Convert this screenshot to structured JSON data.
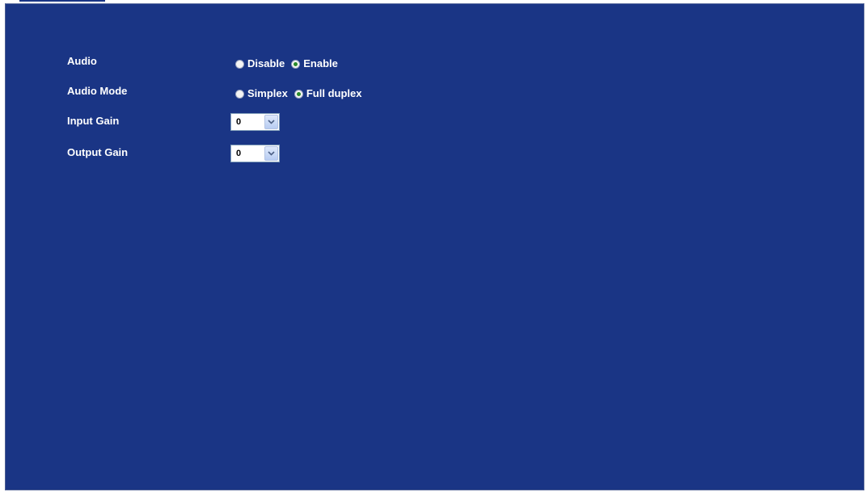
{
  "settings": {
    "audio": {
      "label": "Audio",
      "options": [
        "Disable",
        "Enable"
      ],
      "selected": "Enable"
    },
    "audio_mode": {
      "label": "Audio Mode",
      "options": [
        "Simplex",
        "Full duplex"
      ],
      "selected": "Full duplex"
    },
    "input_gain": {
      "label": "Input Gain",
      "value": "0"
    },
    "output_gain": {
      "label": "Output Gain",
      "value": "0"
    }
  },
  "colors": {
    "panel_background": "#1a3585",
    "text": "#ffffff",
    "radio_checked_dot": "#2a8a2a"
  }
}
